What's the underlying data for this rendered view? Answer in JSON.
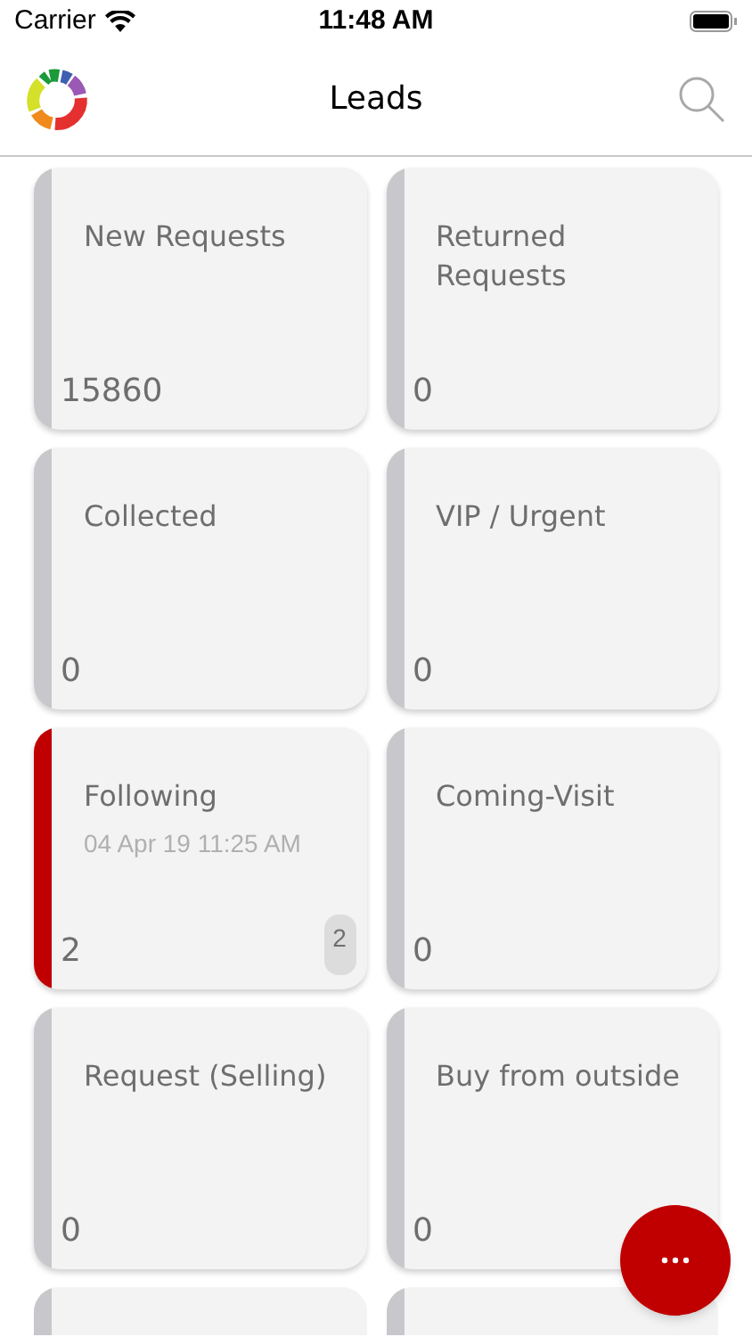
{
  "status_bar": {
    "carrier": "Carrier",
    "time": "11:48 AM"
  },
  "nav_bar": {
    "title": "Leads"
  },
  "cards": [
    {
      "title": "New Requests",
      "count": "15860",
      "color": "#c8c8cc"
    },
    {
      "title": "Returned Requests",
      "count": "0",
      "color": "#c8c8cc"
    },
    {
      "title": "Collected",
      "count": "0",
      "color": "#c8c8cc"
    },
    {
      "title": "VIP / Urgent",
      "count": "0",
      "color": "#c8c8cc"
    },
    {
      "title": "Following",
      "subtitle": "04 Apr 19 11:25 AM",
      "count": "2",
      "badge": "2",
      "color": "#c00000"
    },
    {
      "title": "Coming-Visit",
      "count": "0",
      "color": "#c8c8cc"
    },
    {
      "title": "Request (Selling)",
      "count": "0",
      "color": "#c8c8cc"
    },
    {
      "title": "Buy from outside",
      "count": "0",
      "color": "#c8c8cc"
    },
    {
      "color": "#c8c8cc"
    },
    {
      "color": "#c8c8cc"
    }
  ],
  "fab": {
    "kind": "more"
  }
}
